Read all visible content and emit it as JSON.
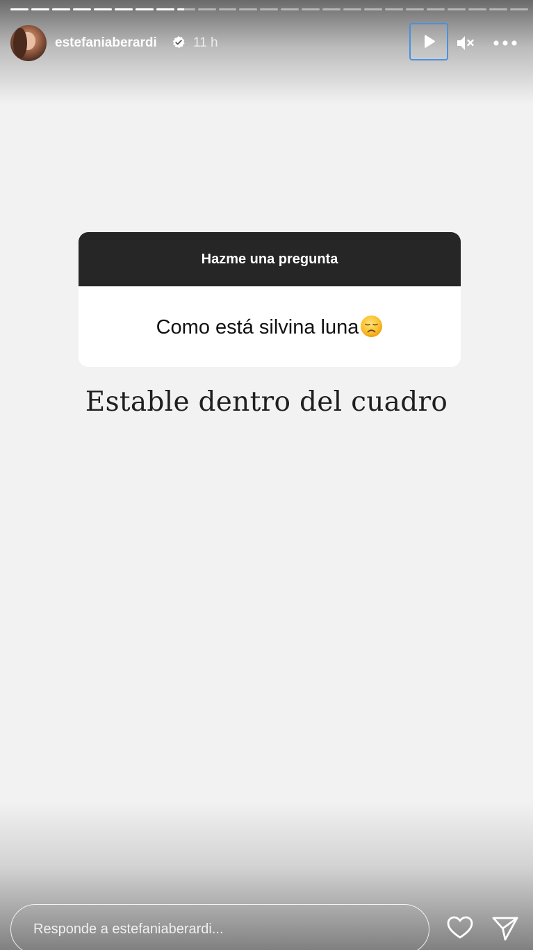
{
  "story": {
    "progress": {
      "segments_total": 25,
      "segments_completed": 8,
      "current_segment_fill": 0.4
    },
    "header": {
      "username": "estefaniaberardi",
      "time_ago": "11 h",
      "icons": {
        "verified": "verified-badge-icon",
        "play": "play-icon",
        "mute": "speaker-muted-icon",
        "more": "more-horizontal-icon"
      }
    },
    "question_sticker": {
      "title": "Hazme una pregunta",
      "question": "Como está silvina luna",
      "emoji": "disappointed-face-emoji"
    },
    "answer_text": "Estable dentro del cuadro",
    "footer": {
      "reply_placeholder": "Responde a estefaniaberardi...",
      "icons": {
        "like": "heart-icon",
        "share": "send-icon"
      }
    }
  },
  "colors": {
    "background": "#f2f2f2",
    "sticker_header": "#262626",
    "sticker_body": "#ffffff",
    "focus_outline": "#4a90e2",
    "text_primary": "#1f1f1f"
  }
}
